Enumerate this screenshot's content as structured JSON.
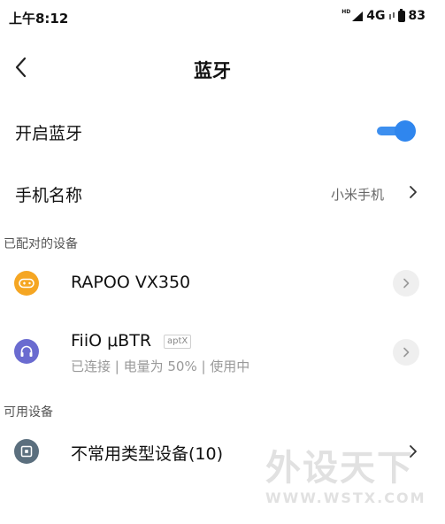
{
  "status_bar": {
    "time": "上午8:12",
    "hd": "HD",
    "network": "4G",
    "battery": "83"
  },
  "header": {
    "back_icon": "chevron-left-icon",
    "title": "蓝牙"
  },
  "bluetooth_toggle": {
    "label": "开启蓝牙",
    "enabled": true,
    "color": "#2f86ee"
  },
  "phone_name": {
    "label": "手机名称",
    "value": "小米手机"
  },
  "paired_section": {
    "title": "已配对的设备",
    "devices": [
      {
        "name": "RAPOO VX350",
        "icon": "gamepad-icon",
        "icon_color": "#f5a623"
      },
      {
        "name": "FiiO μBTR",
        "badge": "aptX",
        "status": "已连接 | 电量为 50% | 使用中",
        "icon": "headphones-icon",
        "icon_color": "#6a6bd0"
      }
    ]
  },
  "available_section": {
    "title": "可用设备",
    "devices": [
      {
        "name": "不常用类型设备(10)",
        "icon": "unknown-device-icon",
        "icon_color": "#5b6f7e"
      }
    ]
  },
  "watermark": {
    "brand": "外设天下",
    "url": "WWW.WSTX.COM"
  }
}
